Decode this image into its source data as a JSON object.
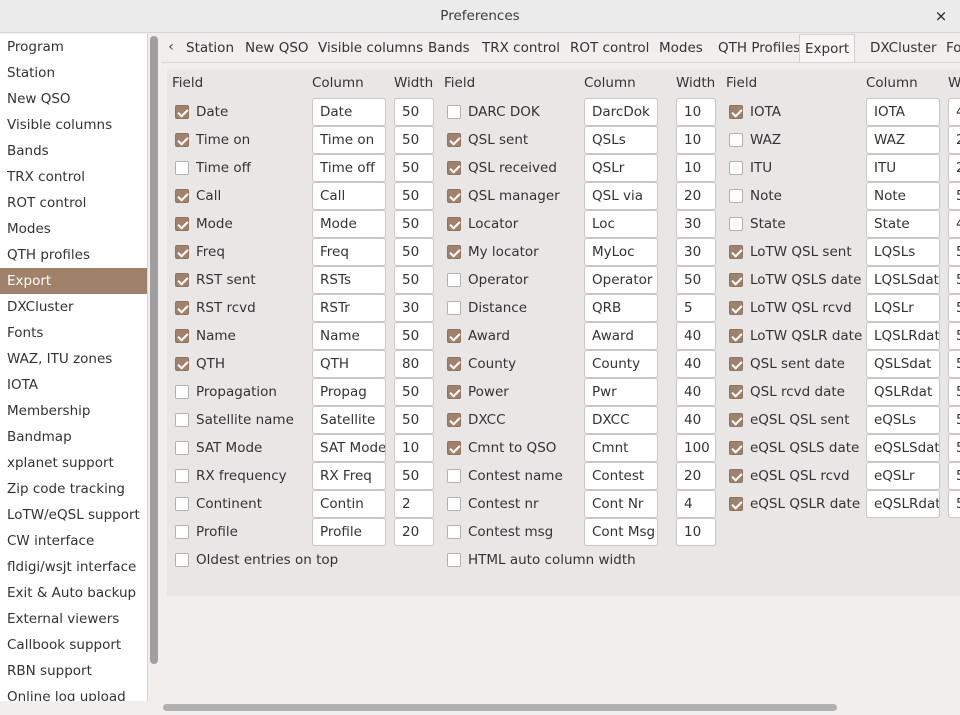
{
  "window": {
    "title": "Preferences",
    "close_glyph": "×"
  },
  "sidebar": {
    "items": [
      "Program",
      "Station",
      "New QSO",
      "Visible columns",
      "Bands",
      "TRX control",
      "ROT control",
      "Modes",
      "QTH profiles",
      "Export",
      "DXCluster",
      "Fonts",
      "WAZ, ITU zones",
      "IOTA",
      "Membership",
      "Bandmap",
      "xplanet support",
      "Zip code tracking",
      "LoTW/eQSL support",
      "CW interface",
      "fldigi/wsjt interface",
      "Exit & Auto backup",
      "External viewers",
      "Callbook support",
      "RBN support",
      "Online log upload"
    ],
    "selected": "Export"
  },
  "tabs": {
    "scroll_left_glyph": "‹",
    "items": [
      "Station",
      "New QSO",
      "Visible columns",
      "Bands",
      "TRX control",
      "ROT control",
      "Modes",
      "QTH Profiles",
      "Export",
      "DXCluster",
      "Fo"
    ],
    "selected": "Export"
  },
  "export": {
    "headers": {
      "field": "Field",
      "column": "Column",
      "width": "Width"
    },
    "columns": [
      [
        {
          "label": "Date",
          "checked": true,
          "column": "Date",
          "width": "50"
        },
        {
          "label": "Time on",
          "checked": true,
          "column": "Time on",
          "width": "50"
        },
        {
          "label": "Time off",
          "checked": false,
          "column": "Time off",
          "width": "50"
        },
        {
          "label": "Call",
          "checked": true,
          "column": "Call",
          "width": "50"
        },
        {
          "label": "Mode",
          "checked": true,
          "column": "Mode",
          "width": "50"
        },
        {
          "label": "Freq",
          "checked": true,
          "column": "Freq",
          "width": "50"
        },
        {
          "label": "RST sent",
          "checked": true,
          "column": "RSTs",
          "width": "50"
        },
        {
          "label": "RST rcvd",
          "checked": true,
          "column": "RSTr",
          "width": "30"
        },
        {
          "label": "Name",
          "checked": true,
          "column": "Name",
          "width": "50"
        },
        {
          "label": "QTH",
          "checked": true,
          "column": "QTH",
          "width": "80"
        },
        {
          "label": "Propagation",
          "checked": false,
          "column": "Propag",
          "width": "50"
        },
        {
          "label": "Satellite name",
          "checked": false,
          "column": "Satellite",
          "width": "50"
        },
        {
          "label": "SAT Mode",
          "checked": false,
          "column": "SAT Mode",
          "width": "10"
        },
        {
          "label": "RX frequency",
          "checked": false,
          "column": "RX Freq",
          "width": "50"
        },
        {
          "label": "Continent",
          "checked": false,
          "column": "Contin",
          "width": "2"
        },
        {
          "label": "Profile",
          "checked": false,
          "column": "Profile",
          "width": "20"
        }
      ],
      [
        {
          "label": "DARC DOK",
          "checked": false,
          "column": "DarcDok",
          "width": "10"
        },
        {
          "label": "QSL sent",
          "checked": true,
          "column": "QSLs",
          "width": "10"
        },
        {
          "label": "QSL received",
          "checked": true,
          "column": "QSLr",
          "width": "10"
        },
        {
          "label": "QSL manager",
          "checked": true,
          "column": "QSL via",
          "width": "20"
        },
        {
          "label": "Locator",
          "checked": true,
          "column": "Loc",
          "width": "30"
        },
        {
          "label": "My locator",
          "checked": true,
          "column": "MyLoc",
          "width": "30"
        },
        {
          "label": "Operator",
          "checked": false,
          "column": "Operator",
          "width": "50"
        },
        {
          "label": "Distance",
          "checked": false,
          "column": "QRB",
          "width": "5"
        },
        {
          "label": "Award",
          "checked": true,
          "column": "Award",
          "width": "40"
        },
        {
          "label": "County",
          "checked": true,
          "column": "County",
          "width": "40"
        },
        {
          "label": "Power",
          "checked": true,
          "column": "Pwr",
          "width": "40"
        },
        {
          "label": "DXCC",
          "checked": true,
          "column": "DXCC",
          "width": "40"
        },
        {
          "label": "Cmnt to QSO",
          "checked": true,
          "column": "Cmnt",
          "width": "100"
        },
        {
          "label": "Contest name",
          "checked": false,
          "column": "Contest",
          "width": "20"
        },
        {
          "label": "Contest nr",
          "checked": false,
          "column": "Cont Nr",
          "width": "4"
        },
        {
          "label": "Contest msg",
          "checked": false,
          "column": "Cont Msg",
          "width": "10"
        }
      ],
      [
        {
          "label": "IOTA",
          "checked": true,
          "column": "IOTA",
          "width": "4"
        },
        {
          "label": "WAZ",
          "checked": false,
          "column": "WAZ",
          "width": "2"
        },
        {
          "label": "ITU",
          "checked": false,
          "column": "ITU",
          "width": "2"
        },
        {
          "label": "Note",
          "checked": false,
          "column": "Note",
          "width": "5"
        },
        {
          "label": "State",
          "checked": false,
          "column": "State",
          "width": "4"
        },
        {
          "label": "LoTW QSL sent",
          "checked": true,
          "column": "LQSLs",
          "width": "5"
        },
        {
          "label": "LoTW QSLS date",
          "checked": true,
          "column": "LQSLSdat",
          "width": "5"
        },
        {
          "label": "LoTW QSL rcvd",
          "checked": true,
          "column": "LQSLr",
          "width": "5"
        },
        {
          "label": "LoTW QSLR date",
          "checked": true,
          "column": "LQSLRdat",
          "width": "5"
        },
        {
          "label": "QSL sent date",
          "checked": true,
          "column": "QSLSdat",
          "width": "5"
        },
        {
          "label": "QSL rcvd date",
          "checked": true,
          "column": "QSLRdat",
          "width": "5"
        },
        {
          "label": "eQSL QSL sent",
          "checked": true,
          "column": "eQSLs",
          "width": "5"
        },
        {
          "label": "eQSL QSLS date",
          "checked": true,
          "column": "eQSLSdat",
          "width": "5"
        },
        {
          "label": "eQSL QSL rcvd",
          "checked": true,
          "column": "eQSLr",
          "width": "5"
        },
        {
          "label": "eQSL QSLR date",
          "checked": true,
          "column": "eQSLRdat",
          "width": "5"
        }
      ]
    ],
    "options": [
      {
        "label": "Oldest entries on top",
        "checked": false
      },
      {
        "label": "HTML auto column width",
        "checked": false
      }
    ]
  },
  "colors": {
    "accent": "#a0826a",
    "panel": "#e8e7e6",
    "window": "#f0efee"
  }
}
